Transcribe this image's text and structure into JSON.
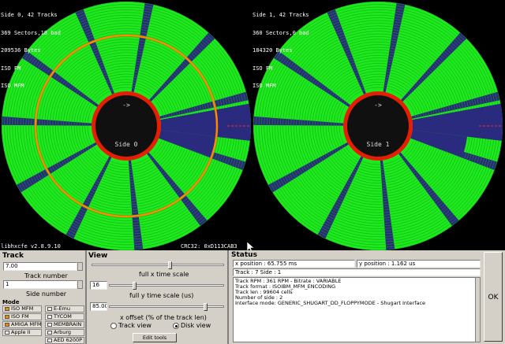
{
  "disk_view": {
    "side0": {
      "line1": "Side 0, 42 Tracks",
      "line2": "369 Sectors,18 bad",
      "line3": "209536 Bytes",
      "line4": "ISO FM",
      "line5": "ISO MFM",
      "center_label": "Side 0",
      "arrow": "->"
    },
    "side1": {
      "line1": "Side 1, 42 Tracks",
      "line2": "360 Sectors,0 bad",
      "line3": "184320 Bytes",
      "line4": "ISO FM",
      "line5": "ISO MFM",
      "center_label": "Side 1",
      "arrow": "->"
    },
    "version": "libhxcfe v2.8.9.10",
    "crc": "CRC32: 0xD113CAB3",
    "colors": {
      "ok": "#1ee81e",
      "bad": "#2a2a7e",
      "selected_track": "#ff8800",
      "index": "#e61e00"
    }
  },
  "track_panel": {
    "title": "Track",
    "track_value": "7.00",
    "track_label": "Track number",
    "side_value": "1",
    "side_label": "Side number"
  },
  "mode_panel": {
    "title": "Mode",
    "buttons": [
      {
        "label": "ISO MFM",
        "on": true
      },
      {
        "label": "E-Emu",
        "on": false
      },
      {
        "label": "ISO FM",
        "on": true
      },
      {
        "label": "TYCOM",
        "on": false
      },
      {
        "label": "AMIGA MFM",
        "on": true
      },
      {
        "label": "MEMBRAIN",
        "on": false
      },
      {
        "label": "Apple II",
        "on": false
      },
      {
        "label": "Arburg",
        "on": false
      },
      {
        "label": "AED 6200P",
        "on": false
      }
    ]
  },
  "view_panel": {
    "title": "View",
    "scale_label": "full x time scale",
    "y_scale_value": "16",
    "y_scale_label": "full y time scale (us)",
    "x_offset_value": "85.00",
    "x_offset_label": "x offset (% of the track len)",
    "track_view_label": "Track view",
    "disk_view_label": "Disk view",
    "edit_tools_label": "Edit tools"
  },
  "status_panel": {
    "title": "Status",
    "x_position": "x position : 65.755 ms",
    "y_position": "y position : 1.162 us",
    "track_side": "Track : 7 Side : 1",
    "details": "Track RPM : 361 RPM - Bitrate : VARIABLE\nTrack format : ISOIBM_MFM_ENCODING\nTrack len : 99604 cells\nNumber of side : 2\nInterface mode: GENERIC_SHUGART_DD_FLOPPYMODE - Shugart Interface",
    "ok_label": "OK"
  }
}
